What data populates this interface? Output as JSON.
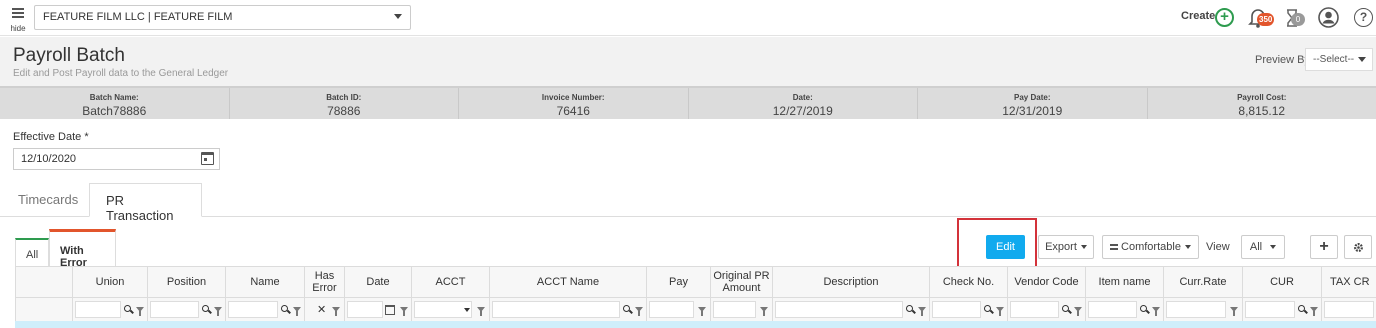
{
  "topbar": {
    "hide_label": "hide",
    "company": "FEATURE FILM LLC | FEATURE FILM",
    "create_label": "Create",
    "notifications_count": "350",
    "pending_count": "0"
  },
  "header": {
    "title": "Payroll Batch",
    "subtitle": "Edit and Post Payroll data to the General Ledger",
    "preview_by_label": "Preview By",
    "preview_by_value": "--Select--"
  },
  "summary": [
    {
      "label": "Batch Name:",
      "value": "Batch78886"
    },
    {
      "label": "Batch ID:",
      "value": "78886"
    },
    {
      "label": "Invoice Number:",
      "value": "76416"
    },
    {
      "label": "Date:",
      "value": "12/27/2019"
    },
    {
      "label": "Pay Date:",
      "value": "12/31/2019"
    },
    {
      "label": "Payroll Cost:",
      "value": "8,815.12"
    }
  ],
  "effective_date": {
    "label": "Effective Date *",
    "value": "12/10/2020"
  },
  "tabs": [
    {
      "label": "Timecards"
    },
    {
      "label": "PR Transaction"
    }
  ],
  "subtabs": {
    "all": "All",
    "with_error": "With Error"
  },
  "toolbar": {
    "edit": "Edit",
    "export": "Export",
    "density": "Comfortable",
    "view_label": "View",
    "view_value": "All"
  },
  "columns": [
    "Union",
    "Position",
    "Name",
    "Has Error",
    "Date",
    "ACCT",
    "ACCT Name",
    "Pay",
    "Original PR Amount",
    "Description",
    "Check No.",
    "Vendor Code",
    "Item name",
    "Curr.Rate",
    "CUR",
    "TAX CR"
  ],
  "colors": {
    "accent": "#11aaee",
    "error": "#e2552c",
    "success": "#2e9b4f",
    "highlight_box": "#d3323a"
  }
}
